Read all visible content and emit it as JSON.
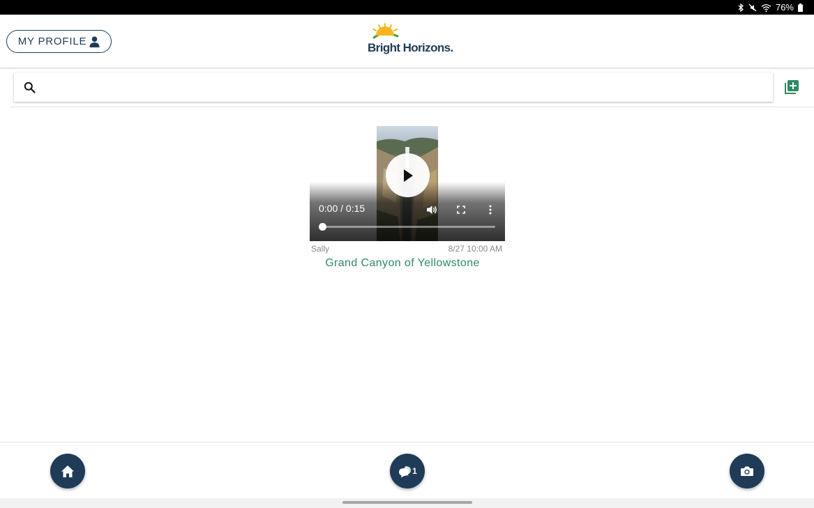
{
  "status_bar": {
    "battery": "76%",
    "icons": [
      "bluetooth-icon",
      "mute-icon",
      "wifi-icon",
      "battery-icon"
    ]
  },
  "header": {
    "profile_label": "MY PROFILE",
    "logo_text": "Bright Horizons."
  },
  "search": {
    "placeholder": "",
    "value": ""
  },
  "post": {
    "author": "Sally",
    "date": "8/27 10:00 AM",
    "title": "Grand Canyon of Yellowstone",
    "video": {
      "time": "0:00 / 0:15",
      "progress": 0
    }
  },
  "bottom_nav": {
    "chat_badge": "1"
  },
  "colors": {
    "navy": "#1f3b57",
    "green": "#2e8a64",
    "logo_green": "#3aa43a",
    "logo_yellow": "#f7b61b"
  }
}
